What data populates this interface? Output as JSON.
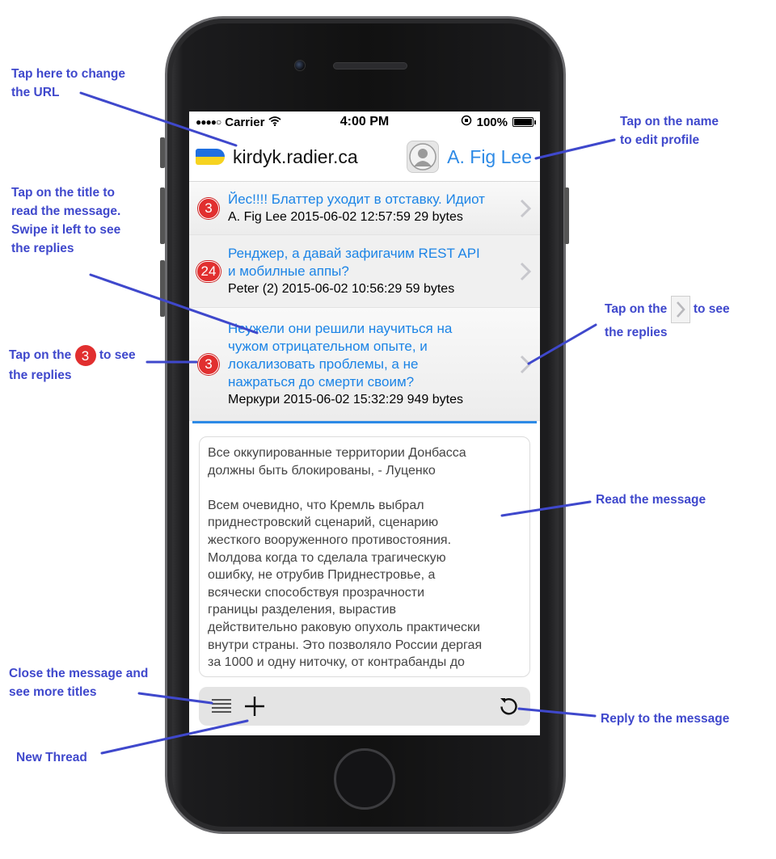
{
  "status_bar": {
    "signal": "●●●●○",
    "carrier": "Carrier",
    "time": "4:00 PM",
    "battery": "100%",
    "battery_level": 1.0
  },
  "header": {
    "site_url": "kirdyk.radier.ca",
    "user_name": "A. Fig Lee"
  },
  "threads": [
    {
      "badge": "3",
      "title_lines": [
        "Йес!!!! Блаттер уходит в отставку. Идиот"
      ],
      "meta": "A. Fig Lee 2015-06-02 12:57:59 29 bytes"
    },
    {
      "badge": "24",
      "title_lines": [
        "Ренджер, а давай зафигачим REST API",
        "и мобилные аппы?"
      ],
      "meta": "Peter (2) 2015-06-02 10:56:29 59 bytes"
    },
    {
      "badge": "3",
      "title_lines": [
        "Неужели они решили научиться на",
        "чужом отрицательном опыте, и",
        "локализовать проблемы, а не",
        "нажраться до смерти своим?"
      ],
      "meta": "Меркури 2015-06-02 15:32:29 949 bytes"
    }
  ],
  "message": {
    "lines": [
      "Все оккупированные территории Донбасса",
      "должны быть блокированы, - Луценко",
      "",
      "Всем очевидно, что Кремль выбрал",
      "приднестровский сценарий, сценарию",
      "жесткого вооруженного противостояния.",
      "Молдова когда то сделала трагическую",
      "ошибку, не отрубив Приднестровье, а",
      "всячески способствуя прозрачности",
      "границы разделения, вырастив",
      "действительно раковую опухоль практически",
      "внутри страны. Это позволяло России дергая",
      "за 1000 и одну ниточку, от контрабанды до"
    ]
  },
  "toolbar": {
    "icons": [
      "list-icon",
      "plus-icon",
      "reply-icon"
    ]
  },
  "annotations": {
    "change_url": [
      "Tap here to change",
      "the URL"
    ],
    "edit_profile": [
      "Tap on the name",
      "to edit profile"
    ],
    "read_title": [
      "Tap on the title to",
      "read the message.",
      "Swipe it left to see",
      "the replies"
    ],
    "badge_replies_pre": "Tap on the",
    "badge_replies_badge": "3",
    "badge_replies_post": "to see",
    "badge_replies_line2": "the replies",
    "chevron_replies_pre": "Tap on the",
    "chevron_replies_post": "to see",
    "chevron_replies_line2": "the replies",
    "read_message": "Read the message",
    "close_message": [
      "Close the message and",
      "see more titles"
    ],
    "reply": "Reply to the message",
    "new_thread": "New Thread"
  },
  "colors": {
    "accent_blue": "#2d8ae6",
    "badge_red": "#e12f2f",
    "annotation_blue": "#3f48cc"
  }
}
